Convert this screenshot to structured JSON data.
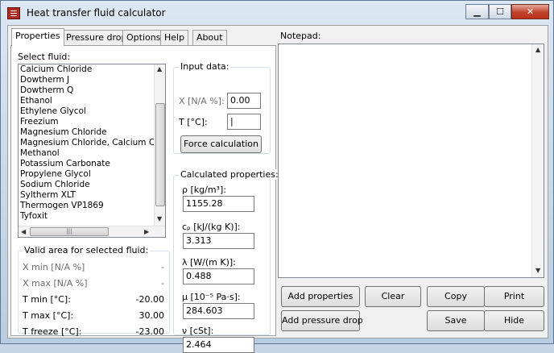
{
  "window": {
    "title": "Heat transfer fluid calculator",
    "minimize_glyph": "▁",
    "maximize_glyph": "☐",
    "close_glyph": "✕"
  },
  "tabs": [
    "Properties",
    "Pressure drop",
    "Options",
    "Help",
    "About"
  ],
  "fluid_selector": {
    "label": "Select fluid:",
    "items": [
      "Calcium Chloride",
      "Dowtherm J",
      "Dowtherm Q",
      "Ethanol",
      "Ethylene Glycol",
      "Freezium",
      "Magnesium Chloride",
      "Magnesium Chloride, Calcium Chlo",
      "Methanol",
      "Potassium Carbonate",
      "Propylene Glycol",
      "Sodium Chloride",
      "Syltherm XLT",
      "Thermogen VP1869",
      "Tyfoxit"
    ]
  },
  "input_data": {
    "title": "Input data:",
    "x_label": "X [N/A %]:",
    "x_value": "0.00",
    "t_label": "T [°C]:",
    "t_value": "|",
    "force_button": "Force calculation"
  },
  "valid_area": {
    "title": "Valid area for selected fluid:",
    "rows": [
      {
        "label": "X min [N/A %]",
        "value": "-"
      },
      {
        "label": "X max [N/A %]",
        "value": "-"
      },
      {
        "label": "T min [°C]:",
        "value": "-20.00"
      },
      {
        "label": "T max [°C]:",
        "value": "30.00"
      },
      {
        "label": "T freeze [°C]:",
        "value": "-23.00"
      }
    ]
  },
  "calculated": {
    "title": "Calculated properties:",
    "density": {
      "label": "ρ [kg/m³]:",
      "value": "1155.28"
    },
    "heat_capacity": {
      "label": "cₚ [kJ/(kg K)]:",
      "value": "3.313"
    },
    "conductivity": {
      "label": "λ [W/(m K)]:",
      "value": "0.488"
    },
    "viscosity": {
      "label": "μ [10⁻⁵ Pa·s]:",
      "value": "284.603"
    },
    "kinematic": {
      "label": "ν [cSt]:",
      "value": "2.464"
    }
  },
  "notepad": {
    "label": "Notepad:",
    "content": ""
  },
  "buttons": {
    "add_properties": "Add properties",
    "add_pressure_drop": "Add pressure drop",
    "clear": "Clear",
    "copy": "Copy",
    "print": "Print",
    "save": "Save",
    "hide": "Hide"
  }
}
